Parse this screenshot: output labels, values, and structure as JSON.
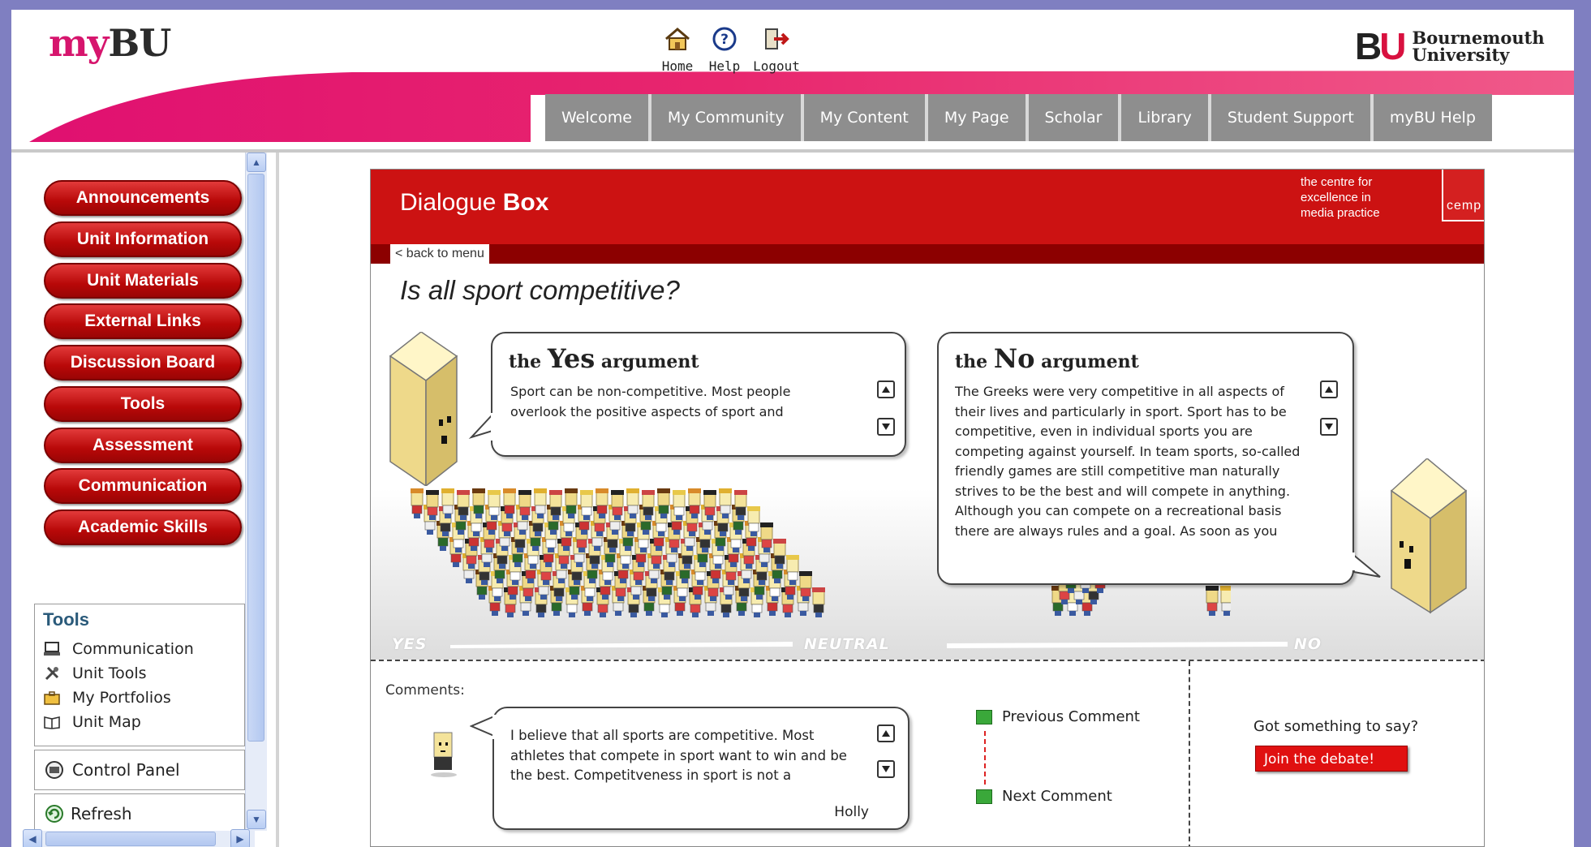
{
  "header": {
    "logo_my": "my",
    "logo_bu": "BU",
    "top_icons": [
      {
        "label": "Home",
        "icon": "home-icon"
      },
      {
        "label": "Help",
        "icon": "help-icon"
      },
      {
        "label": "Logout",
        "icon": "logout-icon"
      }
    ],
    "university_logo": {
      "b": "B",
      "u": "U",
      "line1": "Bournemouth",
      "line2": "University"
    },
    "tabs": [
      "Welcome",
      "My Community",
      "My Content",
      "My Page",
      "Scholar",
      "Library",
      "Student Support",
      "myBU Help"
    ],
    "accent_color": "#d6156d"
  },
  "sidebar": {
    "menu": [
      "Announcements",
      "Unit Information",
      "Unit Materials",
      "External Links",
      "Discussion Board",
      "Tools",
      "Assessment",
      "Communication",
      "Academic Skills"
    ],
    "tools_title": "Tools",
    "tools": [
      {
        "label": "Communication",
        "icon": "computer-icon"
      },
      {
        "label": "Unit Tools",
        "icon": "tools-icon"
      },
      {
        "label": "My Portfolios",
        "icon": "briefcase-icon"
      },
      {
        "label": "Unit Map",
        "icon": "book-icon"
      }
    ],
    "control_panel": "Control Panel",
    "refresh": "Refresh",
    "button_color": "#c20c0c"
  },
  "app": {
    "title_light": "Dialogue ",
    "title_bold": "Box",
    "cemp_text": [
      "the centre for",
      "excellence in",
      "media practice"
    ],
    "cemp_logo": "cemp",
    "back_link": "< back to menu",
    "question": "Is all sport competitive?",
    "yes": {
      "title_pre": "the ",
      "title_big": "Yes",
      "title_post": " argument",
      "text": "Sport can be non-competitive. Most people overlook the positive aspects of sport and"
    },
    "no": {
      "title_pre": "the ",
      "title_big": "No",
      "title_post": " argument",
      "text": "The Greeks were very competitive in all aspects of their lives and particularly in sport. Sport has to be competitive, even in individual sports you are competing against yourself.  In team sports, so-called friendly games are still competitive  man naturally strives to be the best and will compete in anything.  Although you can compete on a recreational basis there are always rules and a goal.  As soon as you"
    },
    "scale": {
      "yes": "YES",
      "neutral": "NEUTRAL",
      "no": "NO"
    },
    "comments_label": "Comments:",
    "comment_text": "I believe that all sports are competitive. Most athletes that compete in sport want to win and be the best. Competitveness in sport is not a",
    "comment_author": "Holly",
    "previous_comment": "Previous Comment",
    "next_comment": "Next Comment",
    "got_something": "Got something to say?",
    "join": "Join the debate!",
    "brand_red": "#cc1212"
  }
}
